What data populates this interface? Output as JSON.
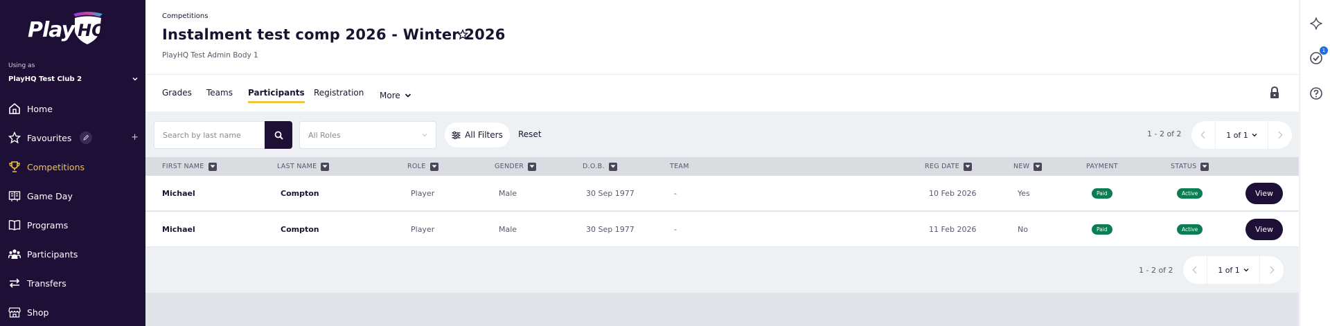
{
  "brand": {
    "logo_text": "Play",
    "logo_mark_text": "HQ"
  },
  "account": {
    "using_as_label": "Using as",
    "club_name": "PlayHQ Test Club 2"
  },
  "nav": {
    "items": [
      {
        "label": "Home",
        "icon": "home-icon"
      },
      {
        "label": "Favourites",
        "icon": "star-icon"
      },
      {
        "label": "Competitions",
        "icon": "trophy-icon",
        "active": true
      },
      {
        "label": "Game Day",
        "icon": "scoreboard-icon"
      },
      {
        "label": "Programs",
        "icon": "book-icon"
      },
      {
        "label": "Participants",
        "icon": "people-icon"
      },
      {
        "label": "Transfers",
        "icon": "transfer-icon"
      },
      {
        "label": "Shop",
        "icon": "shop-icon"
      }
    ],
    "favourites_add": "+"
  },
  "header": {
    "breadcrumb": "Competitions",
    "title": "Instalment test comp 2026 - Winter 2026",
    "organisation": "PlayHQ Test Admin Body 1"
  },
  "tabs": {
    "grades": "Grades",
    "teams": "Teams",
    "participants": "Participants",
    "registration": "Registration",
    "more": "More"
  },
  "filters": {
    "search_placeholder": "Search by last name",
    "role_placeholder": "All Roles",
    "all_filters_label": "All Filters",
    "reset_label": "Reset"
  },
  "pagination": {
    "count_text": "1 - 2 of 2",
    "page_text": "1 of 1"
  },
  "table": {
    "columns": {
      "first_name": "FIRST NAME",
      "last_name": "LAST NAME",
      "role": "ROLE",
      "gender": "GENDER",
      "dob": "D.O.B.",
      "team": "TEAM",
      "reg_date": "REG DATE",
      "new": "NEW",
      "payment": "PAYMENT",
      "status": "STATUS"
    },
    "rows": [
      {
        "first_name": "Michael",
        "last_name": "Compton",
        "role": "Player",
        "gender": "Male",
        "dob": "30 Sep 1977",
        "team": "-",
        "reg_date": "10 Feb 2026",
        "new": "Yes",
        "payment": "Paid",
        "status": "Active",
        "action": "View"
      },
      {
        "first_name": "Michael",
        "last_name": "Compton",
        "role": "Player",
        "gender": "Male",
        "dob": "30 Sep 1977",
        "team": "-",
        "reg_date": "11 Feb 2026",
        "new": "No",
        "payment": "Paid",
        "status": "Active",
        "action": "View"
      }
    ]
  },
  "rail": {
    "notification_count": "1"
  },
  "colors": {
    "sidebar_bg": "#1d0f36",
    "accent": "#f4c341",
    "badge_green": "#0b7d52",
    "notification_blue": "#1f6fe0"
  }
}
